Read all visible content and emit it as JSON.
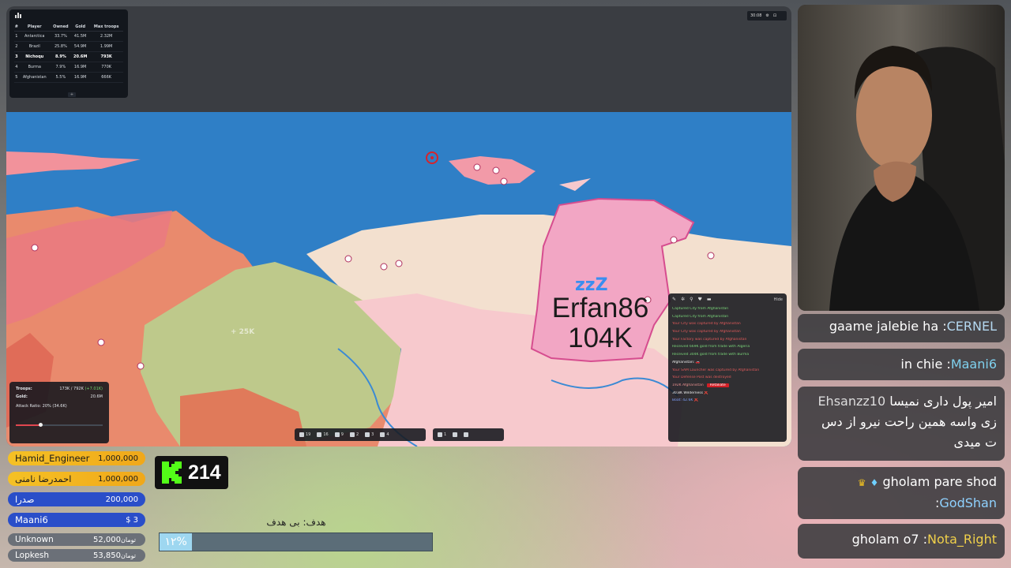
{
  "leaderboard": {
    "headers": [
      "#",
      "Player",
      "Owned",
      "Gold",
      "Max troops"
    ],
    "rows": [
      {
        "rank": "1",
        "player": "Antarctica",
        "owned": "33.7%",
        "gold": "41.5M",
        "max": "2.32M"
      },
      {
        "rank": "2",
        "player": "Brazil",
        "owned": "25.8%",
        "gold": "54.9M",
        "max": "1.99M"
      },
      {
        "rank": "3",
        "player": "Nichoqu",
        "owned": "8.9%",
        "gold": "20.6M",
        "max": "793K"
      },
      {
        "rank": "4",
        "player": "Burma",
        "owned": "7.9%",
        "gold": "16.9M",
        "max": "770K"
      },
      {
        "rank": "5",
        "player": "Afghanistan",
        "owned": "5.5%",
        "gold": "16.9M",
        "max": "666K"
      }
    ],
    "expand_label": "+"
  },
  "top_controls": {
    "timer": "30:08"
  },
  "troops_panel": {
    "troops_label": "Troops:",
    "troops_value": "173K / 792K",
    "troops_delta": "(+7.01K)",
    "gold_label": "Gold:",
    "gold_value": "20.6M",
    "attack_ratio": "Attack Ratio: 20% (34.6K)",
    "attack_ratio_level": 0.28
  },
  "toolbar1": [
    {
      "icon": "city-icon",
      "count": "19"
    },
    {
      "icon": "factory-icon",
      "count": "16"
    },
    {
      "icon": "port-icon",
      "count": "9"
    },
    {
      "icon": "defense-post-icon",
      "count": "2"
    },
    {
      "icon": "missile-silo-icon",
      "count": "3"
    },
    {
      "icon": "sam-launcher-icon",
      "count": "4"
    }
  ],
  "toolbar2": [
    {
      "icon": "warship-icon",
      "count": "1"
    },
    {
      "icon": "atom-bomb-icon",
      "count": ""
    },
    {
      "icon": "hydrogen-bomb-icon",
      "count": ""
    }
  ],
  "map": {
    "player_name": "Erfan86",
    "player_troops": "104K",
    "ghost_label": "+ 25K"
  },
  "event_log": {
    "hide_label": "Hide",
    "lines": [
      {
        "text": "Captured City from Afghanistan",
        "color": "green"
      },
      {
        "text": "Captured City from Afghanistan",
        "color": "green"
      },
      {
        "text": "Your City was captured by Afghanistan",
        "color": "red"
      },
      {
        "text": "Your City was captured by Afghanistan",
        "color": "red"
      },
      {
        "text": "Your Factory was captured by Afghanistan",
        "color": "red"
      },
      {
        "text": "Received 669K gold from trade with Algeria",
        "color": "green"
      },
      {
        "text": "Received 304K gold from trade with Burma",
        "color": "green"
      },
      {
        "text": "Afghanistan: 🚗",
        "color": "white"
      },
      {
        "text": "Your SAM Launcher was captured by Afghanistan",
        "color": "red"
      },
      {
        "text": "Your Defense Post was destroyed",
        "color": "red"
      },
      {
        "text": "192K Afghanistan",
        "color": "pink",
        "button": "Retaliate"
      },
      {
        "text": "30.8K Wilderness ❌",
        "color": "white"
      },
      {
        "text": "Boat: 42.6K ❌",
        "color": "blue"
      }
    ]
  },
  "chat": [
    {
      "user": "CERNEL",
      "message": "gaame jalebie ha",
      "user_class": "u-cernel"
    },
    {
      "user": "Maani6",
      "message": "in chie",
      "user_class": "u-maani"
    },
    {
      "user": "Ehsanzz10",
      "message": "امیر پول داری نمیسا زی واسه همین راحت نیرو از دس ت میدی",
      "user_class": "u-ehsan"
    },
    {
      "user": "GodShan",
      "message": "gholam pare shod",
      "user_class": "u-god"
    },
    {
      "user": "Nota_Right",
      "message": "gholam o7",
      "user_class": "u-nota"
    }
  ],
  "donations": [
    {
      "name": "Hamid_Engineer",
      "amount": "1,000,000",
      "currency": "",
      "style": "gold"
    },
    {
      "name": "احمدرضا نامنی",
      "amount": "1,000,000",
      "currency": "",
      "style": "gold"
    },
    {
      "name": "صدرا",
      "amount": "200,000",
      "currency": "",
      "style": "blue"
    },
    {
      "name": "Maani6",
      "amount": "$ 3",
      "currency": "",
      "style": "blue"
    },
    {
      "name": "Unknown",
      "amount": "52,000",
      "currency": "تومان",
      "style": "grey"
    },
    {
      "name": "Lopkesh",
      "amount": "53,850",
      "currency": "تومان",
      "style": "grey"
    }
  ],
  "kick": {
    "viewers": "214"
  },
  "goal": {
    "title": "هدف: بی هدف",
    "percent_label": "۱۲%",
    "progress": 0.12
  },
  "colors": {
    "ocean": "#2f7fc6",
    "player_territory": "#f2a6c4",
    "pink_nation": "#f7c9cd",
    "salmon_nation": "#e98a6d",
    "olive_nation": "#bec98b",
    "sand_nation": "#f3e0cf",
    "retaliate": "#d21f26"
  }
}
